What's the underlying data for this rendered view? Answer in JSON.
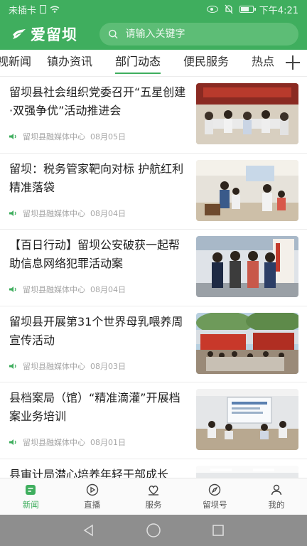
{
  "status": {
    "carrier": "未插卡",
    "time": "下午4:21"
  },
  "header": {
    "logo_text": "爱留坝",
    "search_placeholder": "请输入关键字"
  },
  "tabs": [
    {
      "label": "视新闻"
    },
    {
      "label": "镇办资讯"
    },
    {
      "label": "部门动态",
      "active": true
    },
    {
      "label": "便民服务"
    },
    {
      "label": "热点"
    }
  ],
  "news": [
    {
      "title": "留坝县社会组织党委召开“五星创建·双强争优”活动推进会",
      "source": "留坝县融媒体中心",
      "date": "08月05日"
    },
    {
      "title": "留坝：税务管家靶向对标 护航红利精准落袋",
      "source": "留坝县融媒体中心",
      "date": "08月04日"
    },
    {
      "title": "【百日行动】留坝公安破获一起帮助信息网络犯罪活动案",
      "source": "留坝县融媒体中心",
      "date": "08月04日"
    },
    {
      "title": "留坝县开展第31个世界母乳喂养周宣传活动",
      "source": "留坝县融媒体中心",
      "date": "08月03日"
    },
    {
      "title": "县档案局（馆）“精准滴灌”开展档案业务培训",
      "source": "留坝县融媒体中心",
      "date": "08月01日"
    },
    {
      "title": "县审计局潜心培养年轻干部成长",
      "source": "",
      "date": ""
    }
  ],
  "bottom_nav": [
    {
      "label": "新闻",
      "icon": "news-icon",
      "active": true
    },
    {
      "label": "直播",
      "icon": "live-icon"
    },
    {
      "label": "服务",
      "icon": "service-icon"
    },
    {
      "label": "留坝号",
      "icon": "compass-icon"
    },
    {
      "label": "我的",
      "icon": "profile-icon"
    }
  ],
  "colors": {
    "brand": "#3fae5e",
    "text": "#1e1e1e",
    "meta": "#a5a5a5"
  }
}
